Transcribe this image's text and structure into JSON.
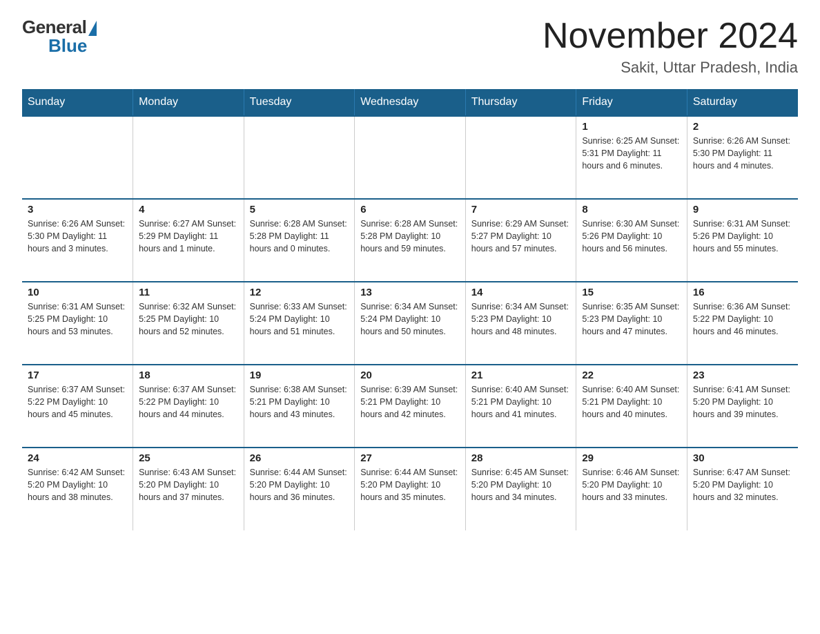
{
  "logo": {
    "general": "General",
    "blue": "Blue"
  },
  "title": "November 2024",
  "location": "Sakit, Uttar Pradesh, India",
  "days_of_week": [
    "Sunday",
    "Monday",
    "Tuesday",
    "Wednesday",
    "Thursday",
    "Friday",
    "Saturday"
  ],
  "weeks": [
    [
      {
        "day": "",
        "info": ""
      },
      {
        "day": "",
        "info": ""
      },
      {
        "day": "",
        "info": ""
      },
      {
        "day": "",
        "info": ""
      },
      {
        "day": "",
        "info": ""
      },
      {
        "day": "1",
        "info": "Sunrise: 6:25 AM\nSunset: 5:31 PM\nDaylight: 11 hours and 6 minutes."
      },
      {
        "day": "2",
        "info": "Sunrise: 6:26 AM\nSunset: 5:30 PM\nDaylight: 11 hours and 4 minutes."
      }
    ],
    [
      {
        "day": "3",
        "info": "Sunrise: 6:26 AM\nSunset: 5:30 PM\nDaylight: 11 hours and 3 minutes."
      },
      {
        "day": "4",
        "info": "Sunrise: 6:27 AM\nSunset: 5:29 PM\nDaylight: 11 hours and 1 minute."
      },
      {
        "day": "5",
        "info": "Sunrise: 6:28 AM\nSunset: 5:28 PM\nDaylight: 11 hours and 0 minutes."
      },
      {
        "day": "6",
        "info": "Sunrise: 6:28 AM\nSunset: 5:28 PM\nDaylight: 10 hours and 59 minutes."
      },
      {
        "day": "7",
        "info": "Sunrise: 6:29 AM\nSunset: 5:27 PM\nDaylight: 10 hours and 57 minutes."
      },
      {
        "day": "8",
        "info": "Sunrise: 6:30 AM\nSunset: 5:26 PM\nDaylight: 10 hours and 56 minutes."
      },
      {
        "day": "9",
        "info": "Sunrise: 6:31 AM\nSunset: 5:26 PM\nDaylight: 10 hours and 55 minutes."
      }
    ],
    [
      {
        "day": "10",
        "info": "Sunrise: 6:31 AM\nSunset: 5:25 PM\nDaylight: 10 hours and 53 minutes."
      },
      {
        "day": "11",
        "info": "Sunrise: 6:32 AM\nSunset: 5:25 PM\nDaylight: 10 hours and 52 minutes."
      },
      {
        "day": "12",
        "info": "Sunrise: 6:33 AM\nSunset: 5:24 PM\nDaylight: 10 hours and 51 minutes."
      },
      {
        "day": "13",
        "info": "Sunrise: 6:34 AM\nSunset: 5:24 PM\nDaylight: 10 hours and 50 minutes."
      },
      {
        "day": "14",
        "info": "Sunrise: 6:34 AM\nSunset: 5:23 PM\nDaylight: 10 hours and 48 minutes."
      },
      {
        "day": "15",
        "info": "Sunrise: 6:35 AM\nSunset: 5:23 PM\nDaylight: 10 hours and 47 minutes."
      },
      {
        "day": "16",
        "info": "Sunrise: 6:36 AM\nSunset: 5:22 PM\nDaylight: 10 hours and 46 minutes."
      }
    ],
    [
      {
        "day": "17",
        "info": "Sunrise: 6:37 AM\nSunset: 5:22 PM\nDaylight: 10 hours and 45 minutes."
      },
      {
        "day": "18",
        "info": "Sunrise: 6:37 AM\nSunset: 5:22 PM\nDaylight: 10 hours and 44 minutes."
      },
      {
        "day": "19",
        "info": "Sunrise: 6:38 AM\nSunset: 5:21 PM\nDaylight: 10 hours and 43 minutes."
      },
      {
        "day": "20",
        "info": "Sunrise: 6:39 AM\nSunset: 5:21 PM\nDaylight: 10 hours and 42 minutes."
      },
      {
        "day": "21",
        "info": "Sunrise: 6:40 AM\nSunset: 5:21 PM\nDaylight: 10 hours and 41 minutes."
      },
      {
        "day": "22",
        "info": "Sunrise: 6:40 AM\nSunset: 5:21 PM\nDaylight: 10 hours and 40 minutes."
      },
      {
        "day": "23",
        "info": "Sunrise: 6:41 AM\nSunset: 5:20 PM\nDaylight: 10 hours and 39 minutes."
      }
    ],
    [
      {
        "day": "24",
        "info": "Sunrise: 6:42 AM\nSunset: 5:20 PM\nDaylight: 10 hours and 38 minutes."
      },
      {
        "day": "25",
        "info": "Sunrise: 6:43 AM\nSunset: 5:20 PM\nDaylight: 10 hours and 37 minutes."
      },
      {
        "day": "26",
        "info": "Sunrise: 6:44 AM\nSunset: 5:20 PM\nDaylight: 10 hours and 36 minutes."
      },
      {
        "day": "27",
        "info": "Sunrise: 6:44 AM\nSunset: 5:20 PM\nDaylight: 10 hours and 35 minutes."
      },
      {
        "day": "28",
        "info": "Sunrise: 6:45 AM\nSunset: 5:20 PM\nDaylight: 10 hours and 34 minutes."
      },
      {
        "day": "29",
        "info": "Sunrise: 6:46 AM\nSunset: 5:20 PM\nDaylight: 10 hours and 33 minutes."
      },
      {
        "day": "30",
        "info": "Sunrise: 6:47 AM\nSunset: 5:20 PM\nDaylight: 10 hours and 32 minutes."
      }
    ]
  ]
}
